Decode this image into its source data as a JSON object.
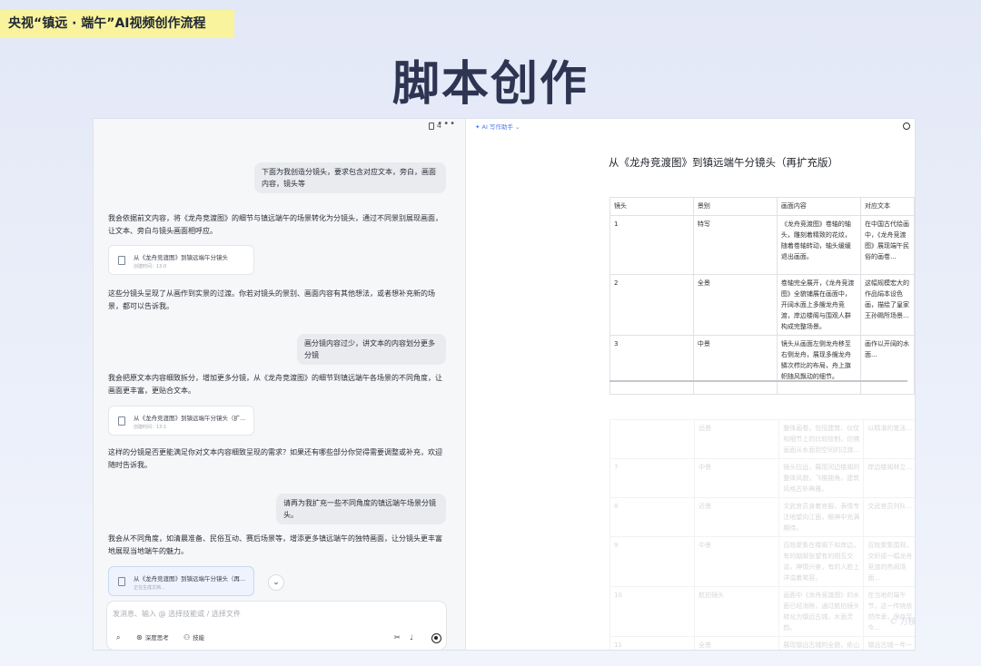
{
  "header": {
    "tag": "央视“镇远 · 端午”AI视频创作流程",
    "title": "脚本创作"
  },
  "chat": {
    "doc_count": "4",
    "messages": [
      {
        "role": "user",
        "text": "下面为我创造分镜头，要求包含对应文本，旁白，画面内容，镜头等"
      },
      {
        "role": "ai",
        "text": "我会依据前文内容，将《龙舟竞渡图》的细节与镇远端午的场景转化为分镜头，通过不同景别展现画面，让文本、旁白与镜头画面相呼应。"
      },
      {
        "role": "file",
        "title": "从《龙舟竞渡图》到镇远端午分镜头",
        "sub": "创建时间：13:0"
      },
      {
        "role": "ai",
        "text": "这些分镜头呈现了从画作到实景的过渡。你若对镜头的景别、画面内容有其他想法，或者想补充新的场景，都可以告诉我。"
      },
      {
        "role": "user",
        "text": "画分镜内容过少，讲文本的内容划分更多分镜"
      },
      {
        "role": "ai",
        "text": "我会把原文本内容细致拆分，增加更多分镜，从《龙舟竞渡图》的细节到镇远端午各场景的不同角度，让画面更丰富，更贴合文本。"
      },
      {
        "role": "file",
        "title": "从《龙舟竞渡图》到镇远端午分镜头（扩...",
        "sub": "创建时间：13:1"
      },
      {
        "role": "ai",
        "text": "这样的分镜是否更能满足你对文本内容细致呈现的需求？如果还有哪些部分你觉得需要调整或补充，欢迎随时告诉我。"
      },
      {
        "role": "user",
        "text": "请再为我扩充一些不同角度的镇远端午场景分镜头。"
      },
      {
        "role": "ai",
        "text": "我会从不同角度，如清晨准备、民俗互动、赛后场景等，增添更多镇远端午的独特画面，让分镜头更丰富地展现当地端午的魅力。"
      },
      {
        "role": "file",
        "title": "从《龙舟竞渡图》到镇远端午分镜头（再...",
        "sub": "正在生成文档..."
      }
    ],
    "composer": {
      "placeholder": "发消息、输入 @ 选择技能或 / 选择文件",
      "deep_think": "深度思考",
      "skills": "技能"
    }
  },
  "doc": {
    "assistant_label": "AI 写作助手",
    "title": "从《龙舟竞渡图》到镇远端午分镜头（再扩充版）",
    "table": {
      "headers": [
        "镜头",
        "景别",
        "画面内容",
        "对应文本"
      ],
      "rows": [
        [
          "1",
          "特写",
          "《龙舟竞渡图》卷轴的轴头，雕刻着精致的花纹，随着卷轴转动，轴头缓缓退出画面。",
          "在中国古代绘画中，《龙舟竞渡图》展现端午民俗的画卷..."
        ],
        [
          "2",
          "全景",
          "卷轴完全展开，《龙舟竞渡图》全貌铺展在画面中，开阔水面上多艘龙舟竞渡，岸边楼阁与围观人群构成完整场景。",
          "这幅规模宏大的作品绢本设色画，描绘了皇家王孙赐所场景..."
        ],
        [
          "3",
          "中景",
          "镜头从画面左侧龙舟移至右侧龙舟，展现多艘龙舟鳞次栉比的布局，舟上旗帜随风飘动的细节。",
          "画作以开阔的水面..."
        ]
      ],
      "faded_rows": [
        [
          "",
          "远景",
          "整体画卷，包括建筑、仪仗和细节上的比较绘制，仿佛画面从水面到空间的过渡...",
          "以精湛的笔法..."
        ],
        [
          "7",
          "中景",
          "镜头拉远，展现河边楼阁的整体风貌，飞檐翘角，建筑风格古朴典雅。",
          "岸边楼阁林立..."
        ],
        [
          "8",
          "近景",
          "文武官员身着官服，表情专注地望向江面，眼神中充满期待。",
          "文武官员列队..."
        ],
        [
          "9",
          "中景",
          "百姓聚集在楼阁下和岸边，有的踮脚张望有的相互交谈，神情兴奋，有的人脸上洋溢着笑容。",
          "百姓聚集围观，交织成一幅龙舟竞渡的热闹场面..."
        ],
        [
          "10",
          "航拍镜头",
          "画面中《龙舟竞渡图》的水面已经消除，通过航拍镜头转化为镇远古城，水面灵韵。",
          "在当地的端午节，这一传统依然传承，保存至今..."
        ],
        [
          "11",
          "全景",
          "展现镇远古城的全貌，依山傍水，屋宇林立，水面映照着古城，城市建筑与自然风景融为一体。",
          "镇远古城一年一度，沿袭至今，展现着古城的独特风韵..."
        ]
      ]
    },
    "watermark": "© 万核 · 知"
  }
}
